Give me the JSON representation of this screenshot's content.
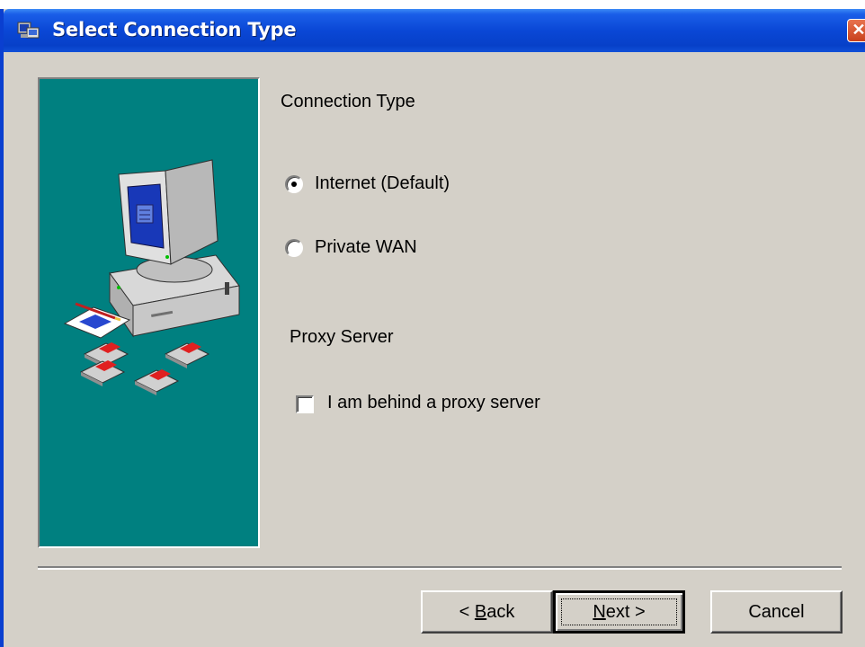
{
  "window": {
    "title": "Select Connection Type",
    "title_icon": "setup-app-icon",
    "close_icon": "close-icon"
  },
  "sidebar_art": {
    "icon": "computer-with-disks-illustration",
    "background": "#008080"
  },
  "connection": {
    "heading": "Connection Type",
    "options": [
      {
        "label": "Internet (Default)",
        "selected": true
      },
      {
        "label": "Private WAN",
        "selected": false
      }
    ]
  },
  "proxy": {
    "heading": "Proxy Server",
    "checkbox_label": "I am behind a proxy server",
    "checked": false
  },
  "buttons": {
    "back_prefix": "< ",
    "back_mnemonic": "B",
    "back_rest": "ack",
    "next_mnemonic": "N",
    "next_rest": "ext >",
    "cancel": "Cancel"
  },
  "colors": {
    "title_bar": "#0a47d6",
    "dialog_face": "#d4d0c8",
    "art_panel": "#008080"
  }
}
